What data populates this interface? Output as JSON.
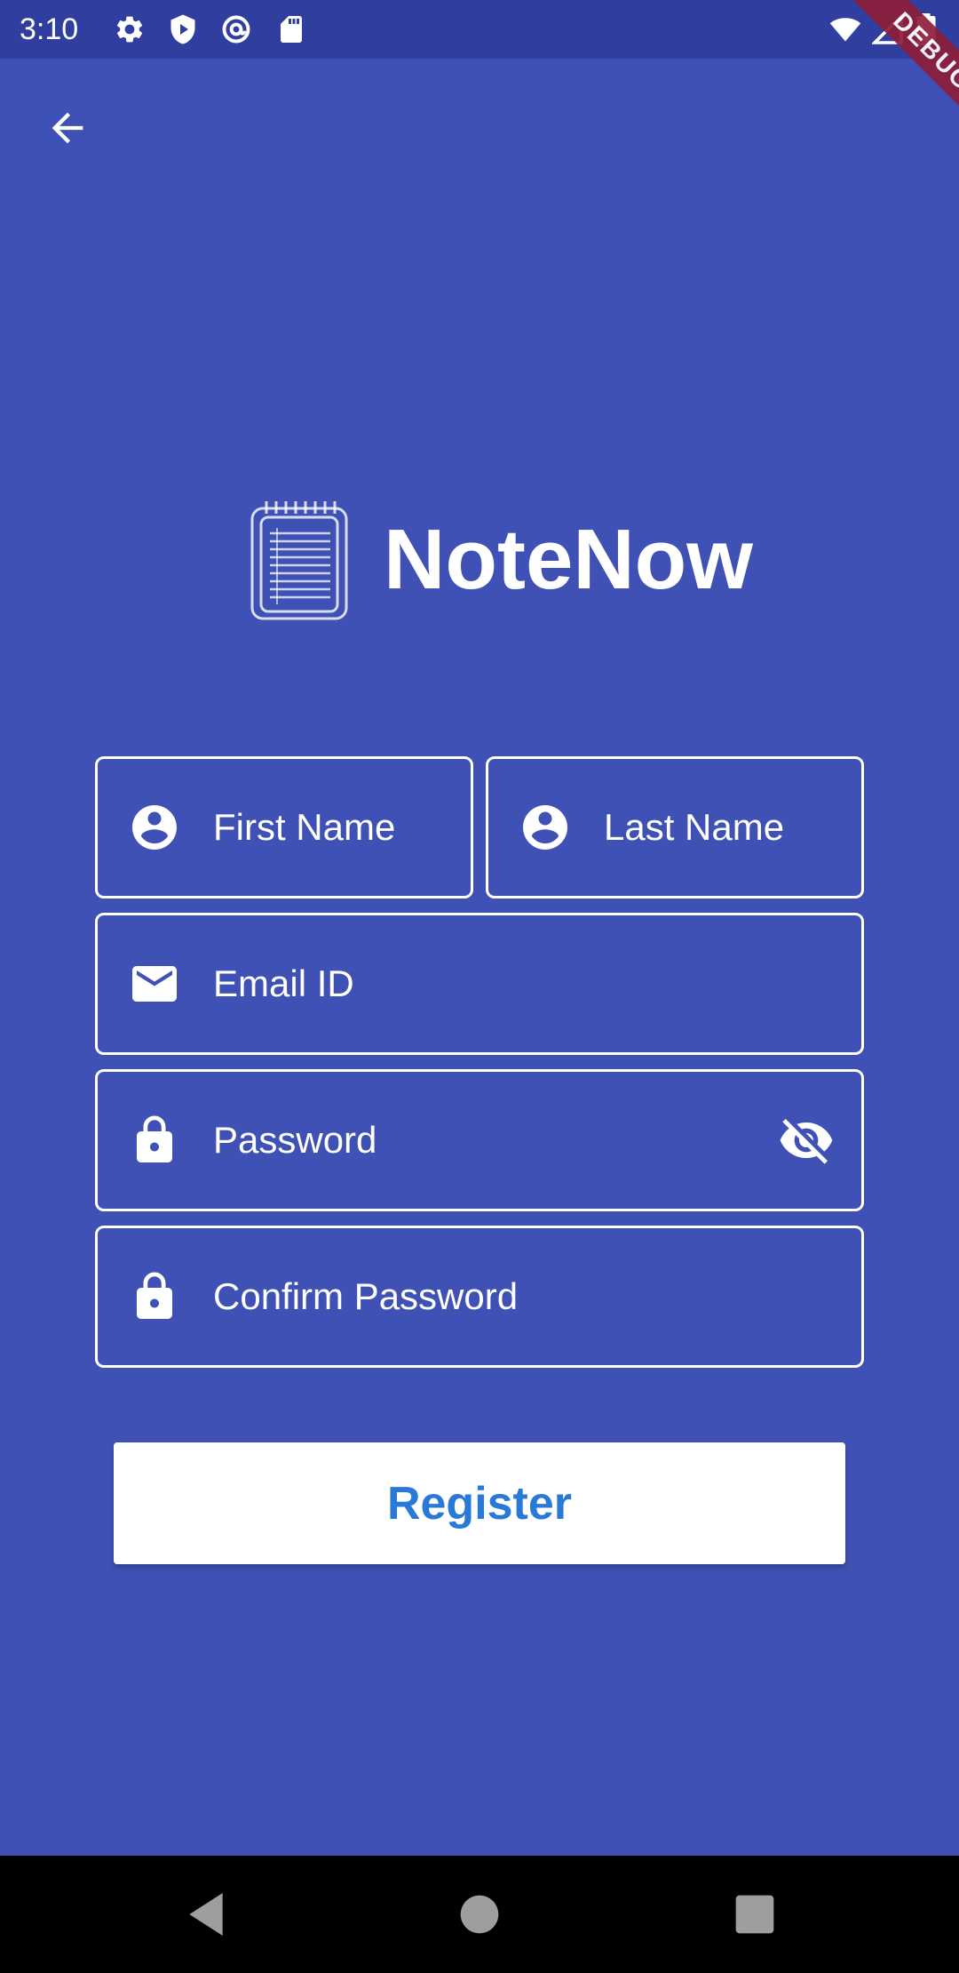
{
  "colors": {
    "background": "#3F51B5",
    "status_bar": "#303F9F",
    "button_text": "#2979D8",
    "debug_banner": "#8E1E3A"
  },
  "status_bar": {
    "time": "3:10",
    "left_icons": [
      "settings-icon",
      "play-protect-icon",
      "at-sign-icon",
      "sd-card-icon"
    ],
    "right_icons": [
      "wifi-icon",
      "cellular-signal-icon",
      "battery-icon"
    ]
  },
  "debug_banner": {
    "label": "DEBUG"
  },
  "header": {
    "back_icon": "arrow-back-icon"
  },
  "brand": {
    "app_name": "NoteNow",
    "logo_icon": "notepad-icon"
  },
  "form": {
    "first_name": {
      "placeholder": "First Name",
      "value": "",
      "icon": "account-circle-icon"
    },
    "last_name": {
      "placeholder": "Last Name",
      "value": "",
      "icon": "account-circle-icon"
    },
    "email": {
      "placeholder": "Email ID",
      "value": "",
      "icon": "mail-icon"
    },
    "password": {
      "placeholder": "Password",
      "value": "",
      "icon": "lock-icon",
      "toggle_icon": "visibility-off-icon"
    },
    "confirm_password": {
      "placeholder": "Confirm Password",
      "value": "",
      "icon": "lock-icon"
    },
    "submit_label": "Register"
  },
  "nav_bar": {
    "buttons": [
      "back-triangle-icon",
      "home-circle-icon",
      "recents-square-icon"
    ]
  }
}
